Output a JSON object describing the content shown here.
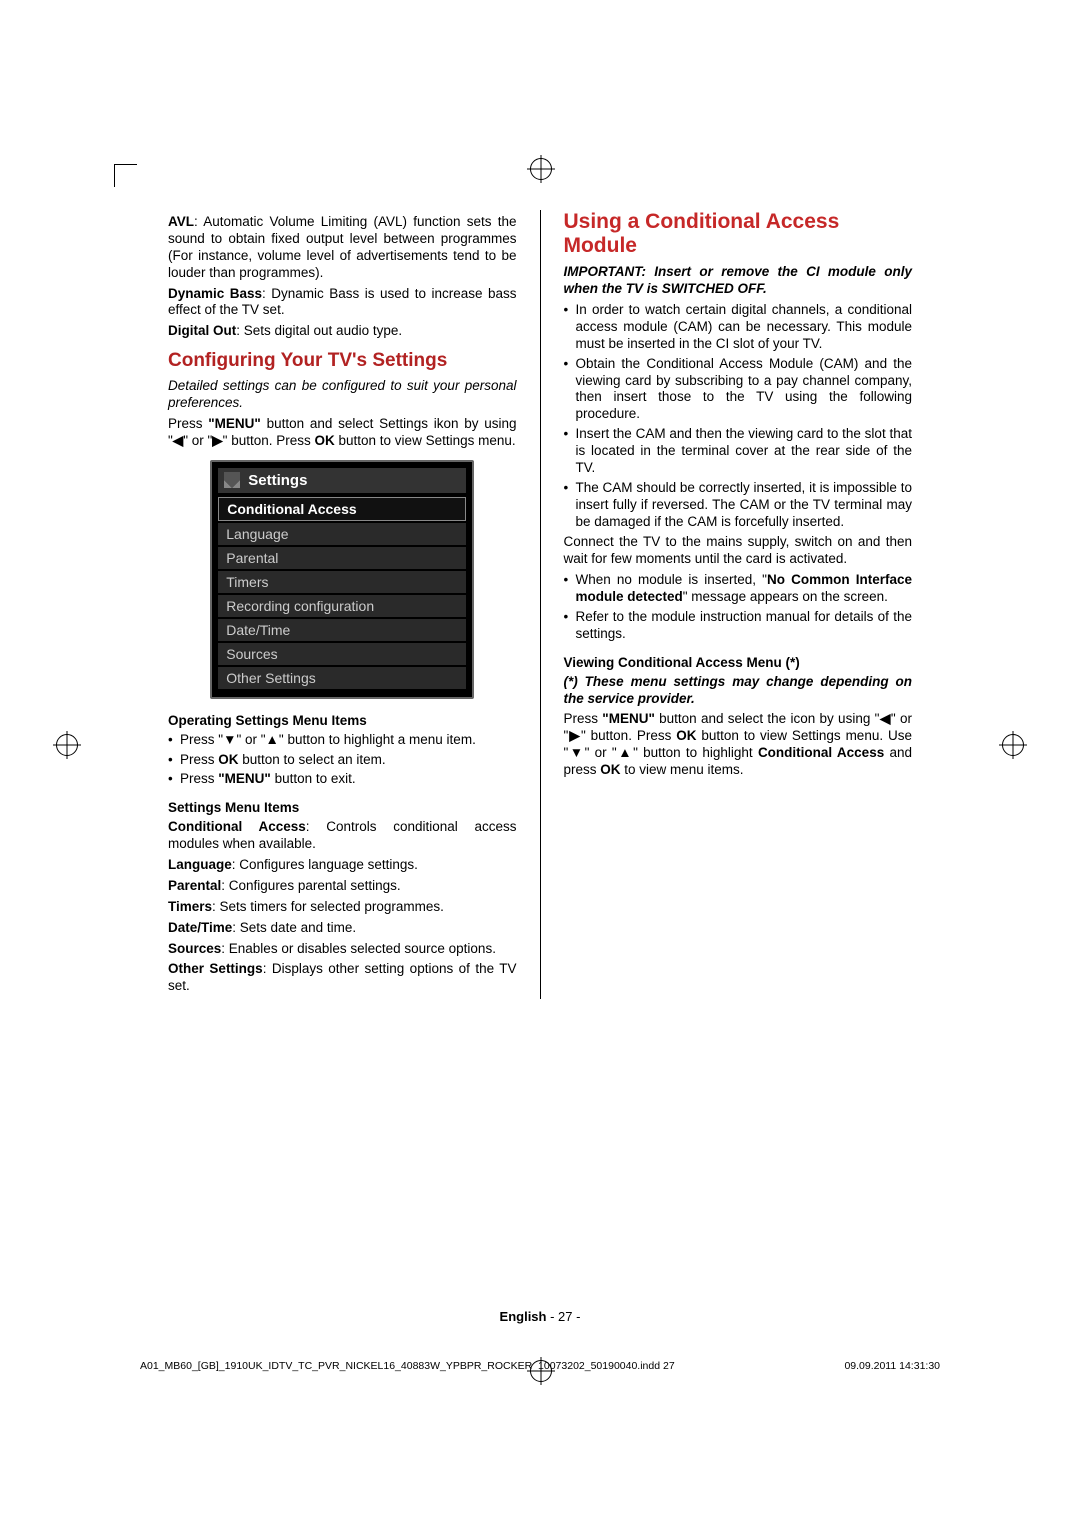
{
  "col1": {
    "avl_label": "AVL",
    "avl_text": ": Automatic Volume Limiting (AVL) function sets the sound to obtain fixed output level between programmes (For instance, volume level of advertisements tend to be louder than programmes).",
    "dyn_label": "Dynamic Bass",
    "dyn_text": ": Dynamic Bass is used to increase bass effect of the TV set.",
    "dout_label": "Digital Out",
    "dout_text": ": Sets digital out audio type.",
    "h_config": "Configuring Your TV's Settings",
    "p_config_intro": "Detailed settings can be configured to suit your personal preferences.",
    "p_press_menu_a": "Press ",
    "p_press_menu_b": "\"MENU\"",
    "p_press_menu_c": " button and select Settings ikon by using \"",
    "p_press_menu_d": "\" or \"",
    "p_press_menu_e": "\" button. Press ",
    "p_press_menu_f": "OK",
    "p_press_menu_g": " button to view Settings menu.",
    "menu": {
      "title": "Settings",
      "items": [
        "Conditional Access",
        "Language",
        "Parental",
        "Timers",
        "Recording configuration",
        "Date/Time",
        "Sources",
        "Other Settings"
      ]
    },
    "h_op": "Operating Settings Menu Items",
    "b1a": "Press \"",
    "b1b": "\" or \"",
    "b1c": "\" button to highlight a menu item.",
    "b2a": "Press ",
    "b2b": "OK",
    "b2c": " button to select an item.",
    "b3a": "Press ",
    "b3b": "\"MENU\"",
    "b3c": " button to exit.",
    "h_items": "Settings Menu Items",
    "d1a": "Conditional Access",
    "d1b": ": Controls conditional access modules when available.",
    "d2a": "Language",
    "d2b": ": Configures language settings.",
    "d3a": "Parental",
    "d3b": ": Configures parental settings.",
    "d4a": "Timers",
    "d4b": ": Sets timers for selected programmes.",
    "d5a": "Date/Time",
    "d5b": ": Sets date and time.",
    "d6a": "Sources",
    "d6b": ": Enables or disables selected source options.",
    "d7a": "Other Settings",
    "d7b": ": Displays other setting options of the TV set."
  },
  "col2": {
    "h_cam": "Using a Conditional Access Module",
    "imp": "IMPORTANT: Insert or remove the CI module only when the TV is SWITCHED OFF.",
    "b1": "In order to watch certain digital channels, a conditional access module (CAM) can be necessary. This module must be inserted in the CI slot of your TV.",
    "b2": "Obtain the Conditional Access Module (CAM) and the viewing card by subscribing to a pay channel company, then insert those to the TV using the following procedure.",
    "b3": "Insert the CAM and then the viewing card to the slot that is located in the terminal cover at the rear side of the TV.",
    "b4": "The CAM should be correctly inserted, it is impossible to insert fully if reversed. The CAM or the TV terminal may be damaged if the CAM is forcefully inserted.",
    "p_conn": "Connect the TV to the mains supply, switch on and then wait for few moments until the card is activated.",
    "b5a": "When no module is inserted, \"",
    "b5b": "No Common Interface module detected",
    "b5c": "\" message appears on the screen.",
    "b6": "Refer to the module instruction manual for details of the settings.",
    "h_view": "Viewing Conditional Access Menu (*)",
    "note": "(*) These menu settings may change depending on the service provider.",
    "p_pressa": "Press ",
    "p_pressb": "\"MENU\"",
    "p_pressc": " button and select the icon by using \"",
    "p_pressd": "\" or \"",
    "p_presse": "\" button. Press ",
    "p_pressf": "OK",
    "p_pressg": " button to view Settings menu. Use \"",
    "p_pressh": "\" or \"",
    "p_pressi": "\" button to highlight ",
    "p_pressj": "Conditional Access",
    "p_pressk": " and press ",
    "p_pressl": "OK",
    "p_pressm": " to view menu items."
  },
  "footer": {
    "lang": "English",
    "page": "   - 27 -"
  },
  "meta": {
    "file": "A01_MB60_[GB]_1910UK_IDTV_TC_PVR_NICKEL16_40883W_YPBPR_ROCKER_10073202_50190040.indd   27",
    "ts": "09.09.2011   14:31:30"
  }
}
